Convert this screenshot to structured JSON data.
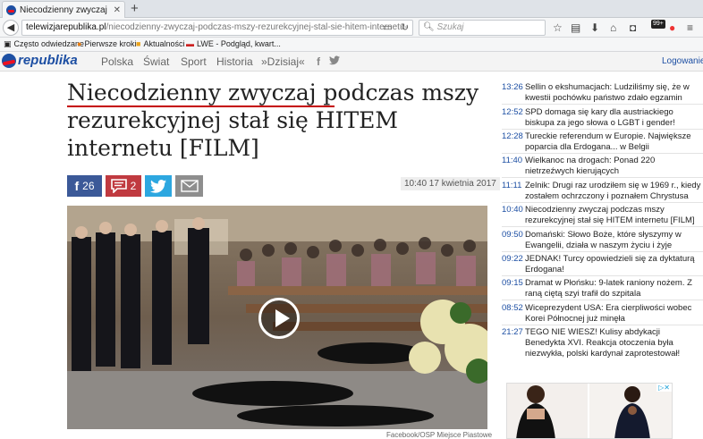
{
  "browser": {
    "tab_title": "Niecodzienny zwyczaj podc",
    "url_host": "telewizjarepublika.pl",
    "url_path": "/niecodzienny-zwyczaj-podczas-mszy-rezurekcyjnej-stal-sie-hitem-internetu-",
    "search_placeholder": "Szukaj",
    "badge": "99+",
    "bookmarks": [
      "Często odwiedzane",
      "Pierwsze kroki",
      "Aktualności",
      "LWE - Podgląd, kwart..."
    ]
  },
  "site": {
    "logo": "republika",
    "menu": [
      "Polska",
      "Świat",
      "Sport",
      "Historia",
      "»Dzisiaj«"
    ],
    "social": [
      "f",
      "twitter"
    ],
    "login": "Logowanie"
  },
  "article": {
    "headline_part1": "Niecodzienny zwyczaj",
    "headline_part2": " podczas mszy rezurekcyjnej stał się HITEM internetu [FILM]",
    "fb_count": "26",
    "comments_count": "2",
    "timestamp": "10:40 17 kwietnia 2017",
    "credit": "Facebook/OSP Miejsce Piastowe"
  },
  "news": [
    {
      "time": "13:26",
      "text": "Sellin o ekshumacjach: Ludziliśmy się, że w kwestii pochówku państwo zdało egzamin"
    },
    {
      "time": "12:52",
      "text": "SPD domaga się kary dla austriackiego biskupa za jego słowa o LGBT i gender!"
    },
    {
      "time": "12:28",
      "text": "Tureckie referendum w Europie. Największe poparcia dla Erdogana... w Belgii"
    },
    {
      "time": "11:40",
      "text": "Wielkanoc na drogach: Ponad 220 nietrzeźwych kierujących"
    },
    {
      "time": "11:11",
      "text": "Zelnik: Drugi raz urodziłem się w 1969 r., kiedy zostałem ochrzczony i poznałem Chrystusa"
    },
    {
      "time": "10:40",
      "text": "Niecodzienny zwyczaj podczas mszy rezurekcyjnej stał się HITEM internetu [FILM]"
    },
    {
      "time": "09:50",
      "text": "Domański: Słowo Boże, które słyszymy w Ewangelii, działa w naszym życiu i żyje"
    },
    {
      "time": "09:22",
      "text": "JEDNAK! Turcy opowiedzieli się za dyktaturą Erdogana!"
    },
    {
      "time": "09:15",
      "text": "Dramat w Płońsku: 9-latek raniony nożem. Z raną ciętą szyi trafił do szpitala"
    },
    {
      "time": "08:52",
      "text": "Wiceprezydent USA: Era cierpliwości wobec Korei Północnej już minęła"
    },
    {
      "time": "21:27",
      "text": "TEGO NIE WIESZ! Kulisy abdykacji Benedykta XVI. Reakcja otoczenia była niezwykła, polski kardynał zaprotestował!"
    }
  ],
  "colors": {
    "accent": "#1d4fa3",
    "headline_underline": "#c40000",
    "facebook": "#3b5998",
    "comments": "#c03a40",
    "twitter": "#2da7e0"
  }
}
